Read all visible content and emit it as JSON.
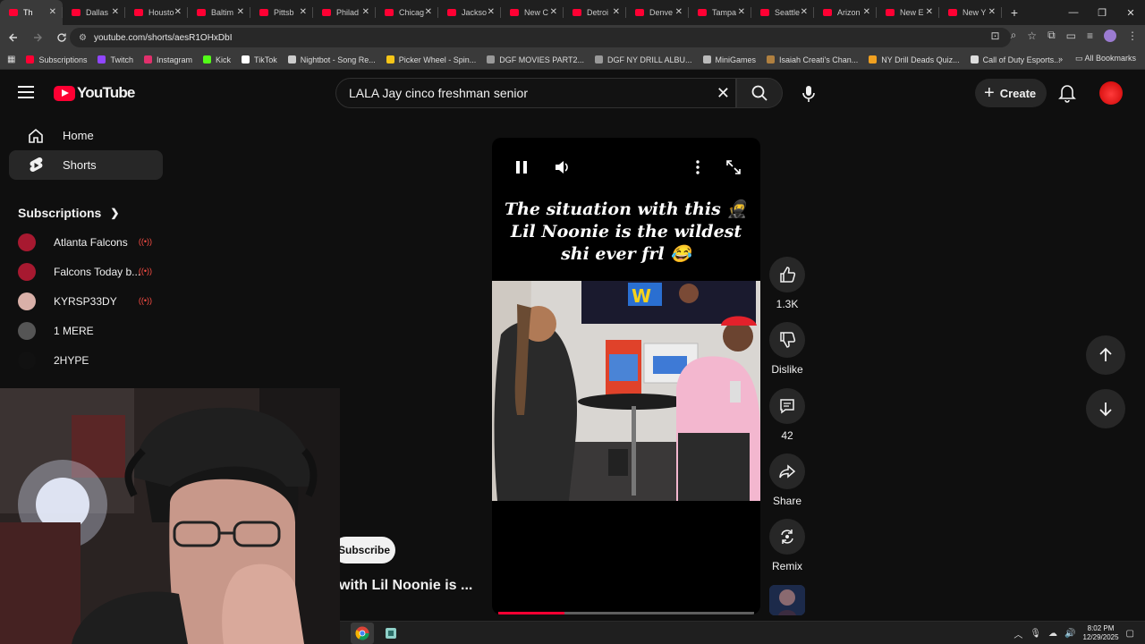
{
  "browser": {
    "tabs": [
      {
        "title": "Th",
        "active": true
      },
      {
        "title": "Dallas"
      },
      {
        "title": "Housto"
      },
      {
        "title": "Baltim"
      },
      {
        "title": "Pittsb"
      },
      {
        "title": "Philad"
      },
      {
        "title": "Chicag"
      },
      {
        "title": "Jackso"
      },
      {
        "title": "New C"
      },
      {
        "title": "Detroi"
      },
      {
        "title": "Denve"
      },
      {
        "title": "Tampa"
      },
      {
        "title": "Seattle"
      },
      {
        "title": "Arizon"
      },
      {
        "title": "New E"
      },
      {
        "title": "New Y"
      }
    ],
    "url": "youtube.com/shorts/aesR1OHxDbI",
    "bookmarks": [
      {
        "label": "Subscriptions",
        "color": "#ff0033"
      },
      {
        "label": "Twitch",
        "color": "#9146ff"
      },
      {
        "label": "Instagram",
        "color": "#e1306c"
      },
      {
        "label": "Kick",
        "color": "#53fc18"
      },
      {
        "label": "TikTok",
        "color": "#ffffff"
      },
      {
        "label": "Nightbot - Song Re...",
        "color": "#cccccc"
      },
      {
        "label": "Picker Wheel - Spin...",
        "color": "#f5c518"
      },
      {
        "label": "DGF MOVIES PART2...",
        "color": "#999999"
      },
      {
        "label": "DGF NY DRILL ALBU...",
        "color": "#999999"
      },
      {
        "label": "MiniGames",
        "color": "#bbbbbb"
      },
      {
        "label": "Isaiah Creati's Chan...",
        "color": "#b08040"
      },
      {
        "label": "NY Drill Deads Quiz...",
        "color": "#f0a020"
      },
      {
        "label": "Call of Duty Esports...",
        "color": "#dddddd"
      }
    ],
    "all_bookmarks": "All Bookmarks"
  },
  "youtube": {
    "logo_text": "YouTube",
    "search_value": "LALA Jay cinco freshman senior",
    "create_label": "Create",
    "sidebar": {
      "items": [
        {
          "label": "Home"
        },
        {
          "label": "Shorts",
          "active": true
        }
      ],
      "subscriptions_heading": "Subscriptions",
      "subscriptions": [
        {
          "name": "Atlanta Falcons",
          "live": true,
          "color": "#a71930"
        },
        {
          "name": "Falcons Today b...",
          "live": true,
          "color": "#a71930"
        },
        {
          "name": "KYRSP33DY",
          "live": true,
          "color": "#d9b0a8"
        },
        {
          "name": "1 MERE",
          "live": false,
          "color": "#555555"
        },
        {
          "name": "2HYPE",
          "live": false,
          "color": "#111111"
        }
      ]
    },
    "short": {
      "caption": [
        "The situation with this 🥷",
        "Lil Noonie is the wildest",
        "shi ever frl 😂"
      ],
      "progress": 0.26,
      "likes": "1.3K",
      "dislike_label": "Dislike",
      "comments": "42",
      "share_label": "Share",
      "remix_label": "Remix",
      "subscribe_label": "Subscribe",
      "title_fragment": "with Lil Noonie is ..."
    }
  },
  "taskbar": {
    "time": "8:02 PM",
    "date": "12/29/2025"
  }
}
